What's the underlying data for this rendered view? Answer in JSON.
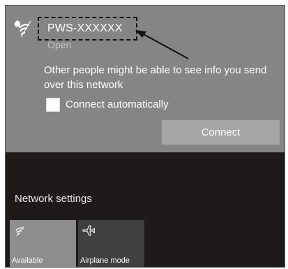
{
  "network": {
    "ssid": "PWS-XXXXXX",
    "status": "Open",
    "warning": "Other people might be able to see info you send over this network",
    "connect_automatically_label": "Connect automatically",
    "connect_automatically_checked": false,
    "connect_button": "Connect",
    "icon": "wifi-shield-icon"
  },
  "footer": {
    "settings_label": "Network settings"
  },
  "quick_actions": [
    {
      "label": "Available",
      "icon": "wifi-icon"
    },
    {
      "label": "Airplane mode",
      "icon": "airplane-icon"
    }
  ],
  "colors": {
    "panel": "#858585",
    "flyout_background": "#1e1a1a",
    "connect_button": "#a6a6a6",
    "tile_available": "#8e8e8e",
    "tile_airplane": "#404040",
    "callout": "#111111"
  }
}
